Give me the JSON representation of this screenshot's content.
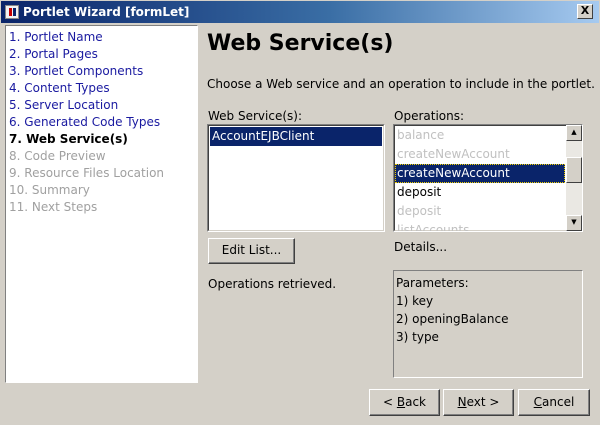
{
  "window": {
    "title": "Portlet Wizard [formLet]",
    "close_glyph": "X",
    "app_icon": "java-icon"
  },
  "steps": [
    {
      "label": "1. Portlet Name",
      "state": "done"
    },
    {
      "label": "2. Portal Pages",
      "state": "done"
    },
    {
      "label": "3. Portlet Components",
      "state": "done"
    },
    {
      "label": "4. Content Types",
      "state": "done"
    },
    {
      "label": "5. Server Location",
      "state": "done"
    },
    {
      "label": "6. Generated Code Types",
      "state": "done"
    },
    {
      "label": "7. Web Service(s)",
      "state": "current"
    },
    {
      "label": "8. Code Preview",
      "state": "future"
    },
    {
      "label": "9. Resource Files Location",
      "state": "future"
    },
    {
      "label": "10. Summary",
      "state": "future"
    },
    {
      "label": "11. Next Steps",
      "state": "future"
    }
  ],
  "main": {
    "title": "Web Service(s)",
    "description": "Choose a Web service and an operation to include in the portlet.",
    "services_label": "Web Service(s):",
    "services": [
      "AccountEJBClient"
    ],
    "selected_service": "AccountEJBClient",
    "operations_label": "Operations:",
    "operations": [
      {
        "name": "balance",
        "state": "dim"
      },
      {
        "name": "createNewAccount",
        "state": "dim"
      },
      {
        "name": "createNewAccount",
        "state": "selected"
      },
      {
        "name": "deposit",
        "state": "normal"
      },
      {
        "name": "deposit",
        "state": "dim"
      },
      {
        "name": "listAccounts",
        "state": "dim"
      }
    ],
    "edit_list_label": "Edit List...",
    "status": "Operations retrieved.",
    "details_label": "Details...",
    "parameters_header": "Parameters:",
    "parameters": [
      "1) key",
      "2) openingBalance",
      "3) type"
    ]
  },
  "footer": {
    "back_prefix": "< ",
    "back_mnemonic": "B",
    "back_rest": "ack",
    "next_mnemonic": "N",
    "next_rest": "ext >",
    "cancel_mnemonic": "C",
    "cancel_rest": "ancel"
  }
}
